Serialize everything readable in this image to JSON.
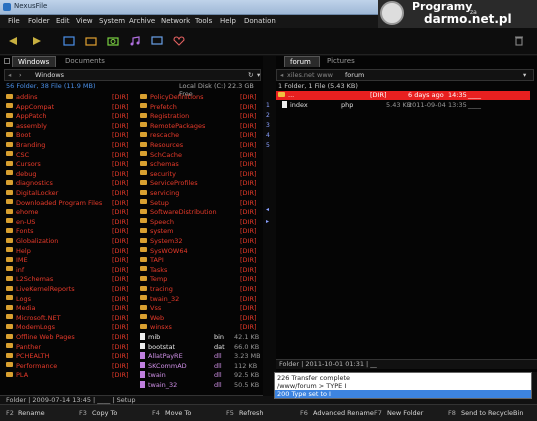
{
  "window": {
    "title": "NexusFile"
  },
  "menu": [
    "File",
    "Folder",
    "Edit",
    "View",
    "System",
    "Archive",
    "Network",
    "Tools",
    "Help",
    "Donation"
  ],
  "watermark": {
    "line1": "Programy",
    "line2": "za",
    "line3": "darmo.net.pl"
  },
  "left": {
    "tabs": [
      "Windows",
      "Documents"
    ],
    "path": "Windows",
    "summary": "56 Folder, 38 File (11.9 MB)",
    "disk": "Local Disk (C:) 22.3 GB Free",
    "status": "Folder  |  2009-07-14 13:45  |  ____  |  Setup",
    "col1": [
      "addins",
      "AppCompat",
      "AppPatch",
      "assembly",
      "Boot",
      "Branding",
      "CSC",
      "Cursors",
      "debug",
      "diagnostics",
      "DigitalLocker",
      "Downloaded Program Files",
      "ehome",
      "en-US",
      "Fonts",
      "Globalization",
      "Help",
      "IME",
      "inf",
      "L2Schemas",
      "LiveKernelReports",
      "Logs",
      "Media",
      "Microsoft.NET",
      "ModemLogs",
      "Offline Web Pages",
      "Panther",
      "PCHEALTH",
      "Performance",
      "PLA"
    ],
    "col2": [
      {
        "name": "PolicyDefinitions",
        "type": "[DIR]",
        "kind": "dir"
      },
      {
        "name": "Prefetch",
        "type": "[DIR]",
        "kind": "dir"
      },
      {
        "name": "Registration",
        "type": "[DIR]",
        "kind": "dir"
      },
      {
        "name": "RemotePackages",
        "type": "[DIR]",
        "kind": "dir"
      },
      {
        "name": "rescache",
        "type": "[DIR]",
        "kind": "dir"
      },
      {
        "name": "Resources",
        "type": "[DIR]",
        "kind": "dir"
      },
      {
        "name": "SchCache",
        "type": "[DIR]",
        "kind": "dir"
      },
      {
        "name": "schemas",
        "type": "[DIR]",
        "kind": "dir"
      },
      {
        "name": "security",
        "type": "[DIR]",
        "kind": "dir"
      },
      {
        "name": "ServiceProfiles",
        "type": "[DIR]",
        "kind": "dir"
      },
      {
        "name": "servicing",
        "type": "[DIR]",
        "kind": "dir"
      },
      {
        "name": "Setup",
        "type": "[DIR]",
        "kind": "dir"
      },
      {
        "name": "SoftwareDistribution",
        "type": "[DIR]",
        "kind": "dir"
      },
      {
        "name": "Speech",
        "type": "[DIR]",
        "kind": "dir"
      },
      {
        "name": "system",
        "type": "[DIR]",
        "kind": "dir"
      },
      {
        "name": "System32",
        "type": "[DIR]",
        "kind": "dir"
      },
      {
        "name": "SysWOW64",
        "type": "[DIR]",
        "kind": "dir"
      },
      {
        "name": "TAPI",
        "type": "[DIR]",
        "kind": "dir"
      },
      {
        "name": "Tasks",
        "type": "[DIR]",
        "kind": "dir"
      },
      {
        "name": "Temp",
        "type": "[DIR]",
        "kind": "dir"
      },
      {
        "name": "tracing",
        "type": "[DIR]",
        "kind": "dir"
      },
      {
        "name": "twain_32",
        "type": "[DIR]",
        "kind": "dir"
      },
      {
        "name": "Vss",
        "type": "[DIR]",
        "kind": "dir"
      },
      {
        "name": "Web",
        "type": "[DIR]",
        "kind": "dir"
      },
      {
        "name": "winsxs",
        "type": "[DIR]",
        "kind": "dir"
      },
      {
        "name": "mib",
        "type": "bin",
        "size": "42.1 KB",
        "kind": "file"
      },
      {
        "name": "bootstat",
        "type": "dat",
        "size": "66.0 KB",
        "kind": "file"
      },
      {
        "name": "AllatPayRE",
        "type": "dll",
        "size": "3.23 MB",
        "kind": "dll"
      },
      {
        "name": "SKCommAD",
        "type": "dll",
        "size": "112 KB",
        "kind": "dll"
      },
      {
        "name": "twain",
        "type": "dll",
        "size": "92.5 KB",
        "kind": "dll"
      },
      {
        "name": "twain_32",
        "type": "dll",
        "size": "50.5 KB",
        "kind": "dll"
      }
    ]
  },
  "right": {
    "tabs": [
      "forum",
      "Pictures"
    ],
    "path": [
      "xiles.net",
      "www",
      "forum"
    ],
    "summary": "1 Folder, 1 File (5.43 KB)",
    "rows": [
      {
        "name": "...",
        "type": "[DIR]",
        "date": "6 days ago",
        "time": "14:35",
        "attr": "____"
      },
      {
        "name": "index",
        "ext": "php",
        "size": "5.43 KB",
        "date": "2011-09-04",
        "time": "13:35",
        "attr": "____"
      }
    ],
    "status": "Folder  |  2011-10-01 01:31  |  __"
  },
  "midstrip": [
    "1",
    "2",
    "3",
    "4",
    "5"
  ],
  "log": [
    "226 Transfer complete",
    "/www/forum > TYPE I",
    "200 Type set to I"
  ],
  "fkeys": [
    {
      "key": "F2",
      "label": "Rename"
    },
    {
      "key": "F3",
      "label": "Copy To"
    },
    {
      "key": "F4",
      "label": "Move To"
    },
    {
      "key": "F5",
      "label": "Refresh"
    },
    {
      "key": "F6",
      "label": "Advanced Rename"
    },
    {
      "key": "F7",
      "label": "New Folder"
    },
    {
      "key": "F8",
      "label": "Send to RecycleBin"
    }
  ],
  "colors": {
    "dir": "#e83a2a",
    "dll": "#d090e8",
    "highlight": "#e82020",
    "accent": "#4a8fe8"
  }
}
